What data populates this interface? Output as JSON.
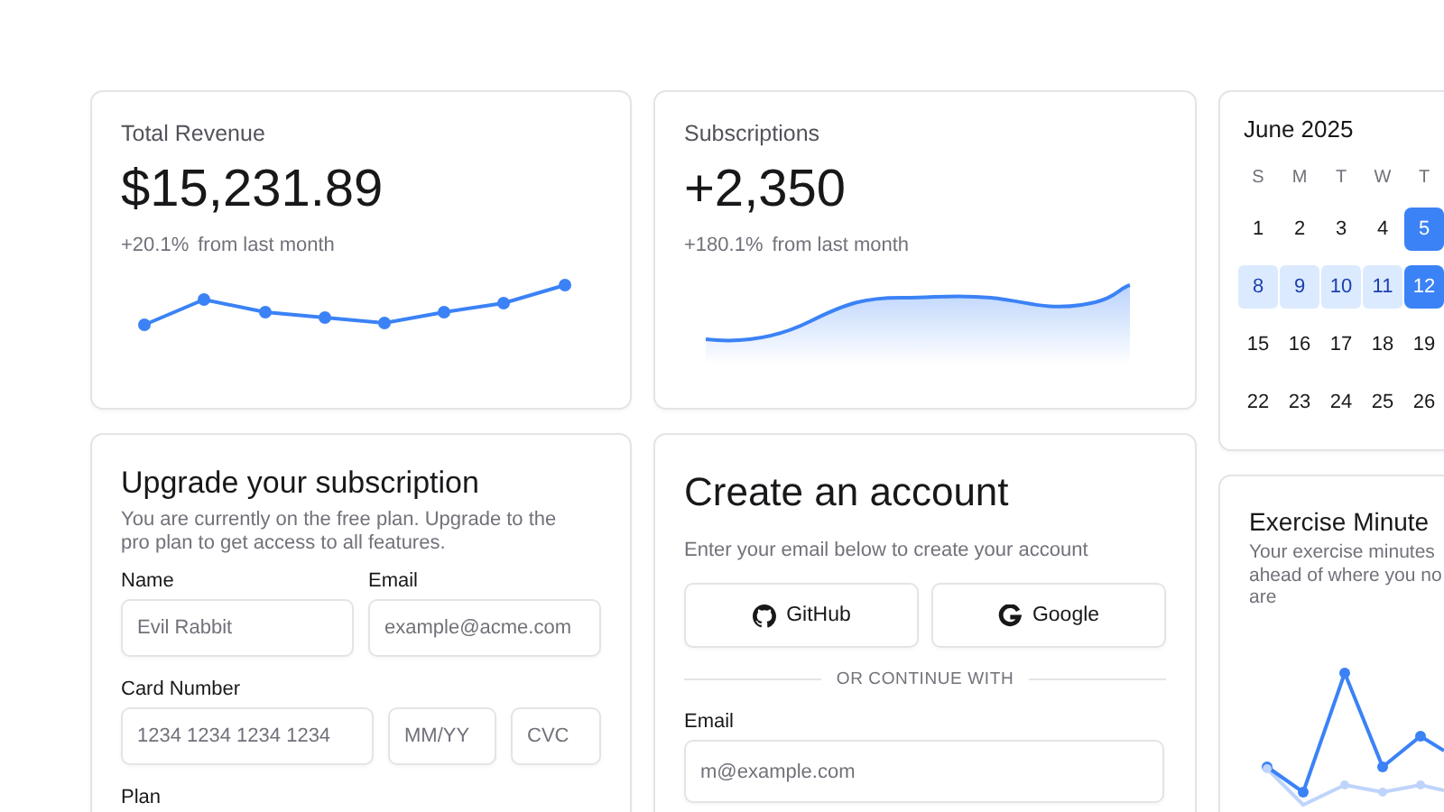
{
  "stats": [
    {
      "kind": "line",
      "title": "Total Revenue",
      "value": "$15,231.89",
      "change": "+20.1%",
      "note": "from last month"
    },
    {
      "kind": "area",
      "title": "Subscriptions",
      "value": "+2,350",
      "change": "+180.1%",
      "note": "from last month"
    }
  ],
  "upgrade": {
    "title": "Upgrade your subscription",
    "description": "You are currently on the free plan. Upgrade to the pro plan to get access to all features.",
    "name": {
      "label": "Name",
      "placeholder": "Evil Rabbit"
    },
    "email": {
      "label": "Email",
      "placeholder": "example@acme.com"
    },
    "card": {
      "label": "Card Number",
      "placeholders": [
        "1234 1234 1234 1234",
        "MM/YY",
        "CVC"
      ]
    },
    "plan_label": "Plan"
  },
  "account": {
    "title": "Create an account",
    "description": "Enter your email below to create your account",
    "buttons": [
      {
        "kind": "github",
        "label": "GitHub"
      },
      {
        "kind": "google",
        "label": "Google"
      }
    ],
    "divider": "OR CONTINUE WITH",
    "email": {
      "label": "Email",
      "placeholder": "m@example.com"
    }
  },
  "calendar": {
    "title": "June 2025",
    "weekdays": [
      "S",
      "M",
      "T",
      "W",
      "T"
    ],
    "weeks": [
      [
        {
          "label": "1",
          "selected": false,
          "in_range": false
        },
        {
          "label": "2",
          "selected": false,
          "in_range": false
        },
        {
          "label": "3",
          "selected": false,
          "in_range": false
        },
        {
          "label": "4",
          "selected": false,
          "in_range": false
        },
        {
          "label": "5",
          "selected": true,
          "in_range": false
        }
      ],
      [
        {
          "label": "8",
          "selected": false,
          "in_range": true
        },
        {
          "label": "9",
          "selected": false,
          "in_range": true
        },
        {
          "label": "10",
          "selected": false,
          "in_range": true
        },
        {
          "label": "11",
          "selected": false,
          "in_range": true
        },
        {
          "label": "12",
          "selected": true,
          "in_range": false
        }
      ],
      [
        {
          "label": "15",
          "selected": false,
          "in_range": false
        },
        {
          "label": "16",
          "selected": false,
          "in_range": false
        },
        {
          "label": "17",
          "selected": false,
          "in_range": false
        },
        {
          "label": "18",
          "selected": false,
          "in_range": false
        },
        {
          "label": "19",
          "selected": false,
          "in_range": false
        }
      ],
      [
        {
          "label": "22",
          "selected": false,
          "in_range": false
        },
        {
          "label": "23",
          "selected": false,
          "in_range": false
        },
        {
          "label": "24",
          "selected": false,
          "in_range": false
        },
        {
          "label": "25",
          "selected": false,
          "in_range": false
        },
        {
          "label": "26",
          "selected": false,
          "in_range": false
        }
      ]
    ]
  },
  "exercise": {
    "title": "Exercise Minute",
    "description_lines": [
      "Your exercise minutes",
      "ahead of where you no",
      "are"
    ]
  }
}
